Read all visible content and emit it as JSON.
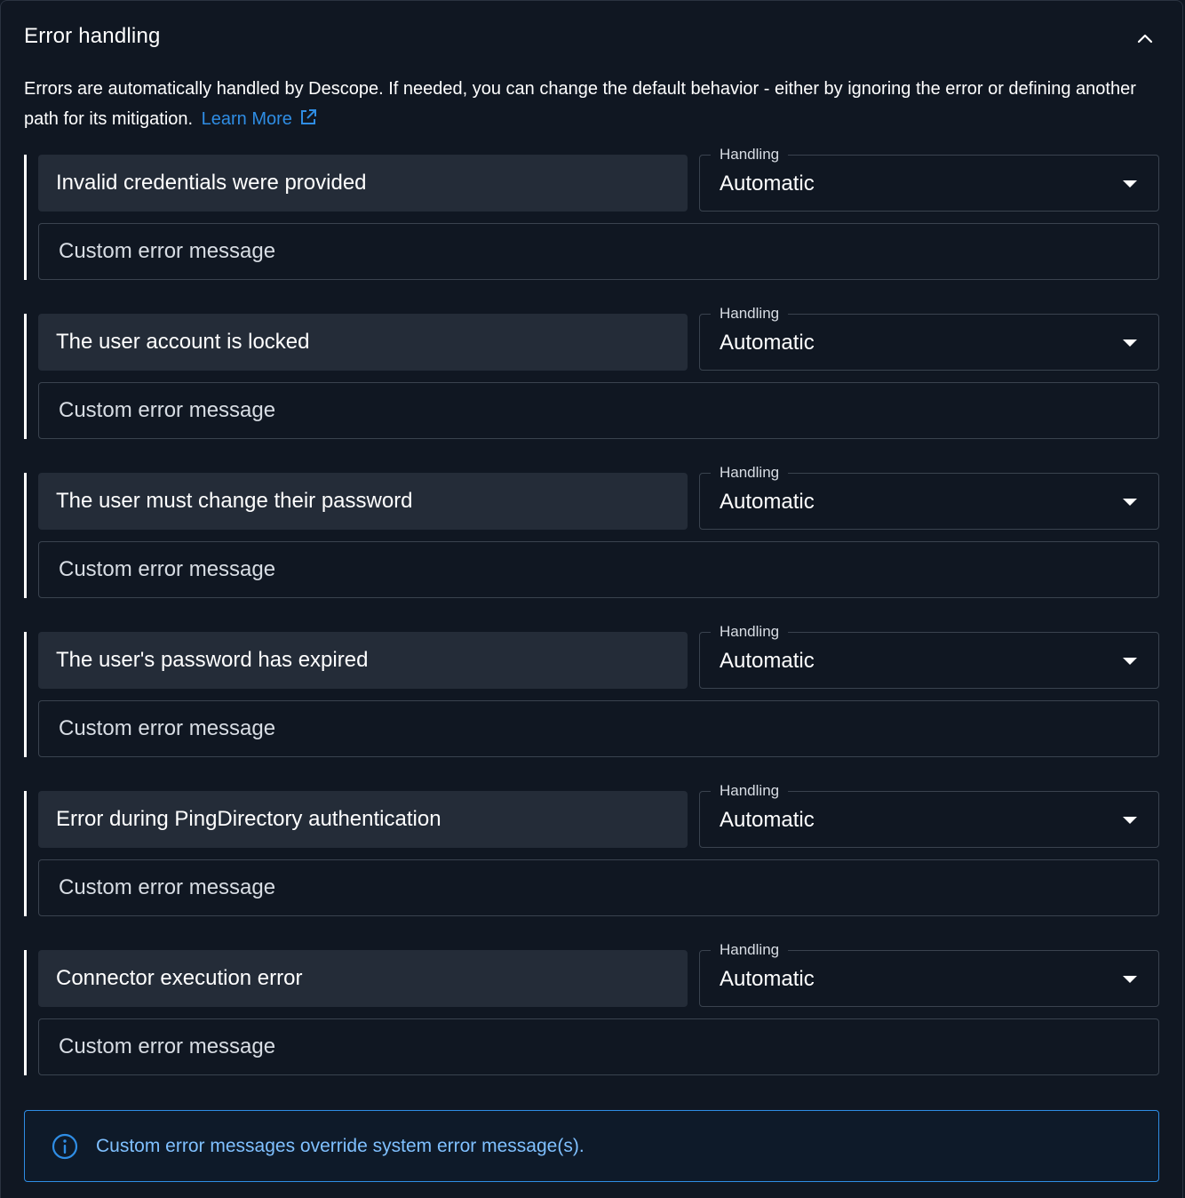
{
  "section": {
    "title": "Error handling",
    "description": "Errors are automatically handled by Descope. If needed, you can change the default behavior - either by ignoring the error or defining another path for its mitigation.",
    "learn_more_label": "Learn More",
    "collapse_icon": "chevron-up-icon",
    "external_link_icon": "external-link-icon"
  },
  "errors": [
    {
      "label": "Invalid credentials were provided",
      "handling_label": "Handling",
      "handling_value": "Automatic",
      "custom_placeholder": "Custom error message"
    },
    {
      "label": "The user account is locked",
      "handling_label": "Handling",
      "handling_value": "Automatic",
      "custom_placeholder": "Custom error message"
    },
    {
      "label": "The user must change their password",
      "handling_label": "Handling",
      "handling_value": "Automatic",
      "custom_placeholder": "Custom error message"
    },
    {
      "label": "The user's password has expired",
      "handling_label": "Handling",
      "handling_value": "Automatic",
      "custom_placeholder": "Custom error message"
    },
    {
      "label": "Error during PingDirectory authentication",
      "handling_label": "Handling",
      "handling_value": "Automatic",
      "custom_placeholder": "Custom error message"
    },
    {
      "label": "Connector execution error",
      "handling_label": "Handling",
      "handling_value": "Automatic",
      "custom_placeholder": "Custom error message"
    }
  ],
  "info": {
    "icon": "info-icon",
    "text": "Custom error messages override system error message(s)."
  },
  "colors": {
    "background": "#101722",
    "accent": "#2f8de4",
    "label_bg": "#242c38",
    "border": "#3a434f"
  }
}
